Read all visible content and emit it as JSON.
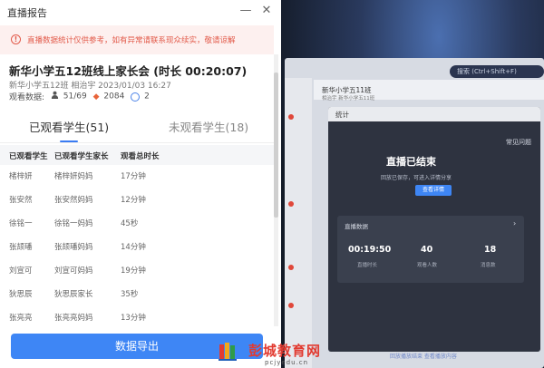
{
  "window": {
    "title": "直播报告",
    "minimize_glyph": "—",
    "close_glyph": "✕"
  },
  "notice": {
    "text": "直播数据统计仅供参考，如有异常请联系现众续实，敬请谅解"
  },
  "meeting": {
    "title": "新华小学五12班线上家长会 (时长 00:20:07)",
    "subtitle": "新华小学五12班  相治宇  2023/01/03 16:27",
    "stats_label": "观看数据:",
    "viewers": "51/69",
    "likes": "2084",
    "comments": "2"
  },
  "tabs": {
    "watched": "已观看学生(51)",
    "unwatched": "未观看学生(18)"
  },
  "table": {
    "headers": [
      "已观看学生",
      "已观看学生家长",
      "观看总时长"
    ],
    "rows": [
      [
        "楮梓妍",
        "楮梓妍妈妈",
        "17分钟"
      ],
      [
        "张安然",
        "张安然妈妈",
        "12分钟"
      ],
      [
        "徐铭一",
        "徐铭一妈妈",
        "45秒"
      ],
      [
        "张颉璠",
        "张颉璠妈妈",
        "14分钟"
      ],
      [
        "刘宣可",
        "刘宣可妈妈",
        "19分钟"
      ],
      [
        "狄思辰",
        "狄思辰家长",
        "35秒"
      ],
      [
        "张亮亮",
        "张亮亮妈妈",
        "13分钟"
      ]
    ]
  },
  "export_button": "数据导出",
  "photo": {
    "search_placeholder": "搜索 (Ctrl+Shift+F)",
    "class_title": "新华小学五11班",
    "class_sub": "相治宇 新华小学五11班",
    "stats_window_title": "统计",
    "faq": "常见问题",
    "ended": "直播已结束",
    "ended_sub": "回放已保存，可进入详情分享",
    "detail_button": "查看详情",
    "card_label": "直播数据",
    "metrics": [
      {
        "value": "00:19:50",
        "label": "直播时长"
      },
      {
        "value": "40",
        "label": "观看人数"
      },
      {
        "value": "18",
        "label": "消息数"
      }
    ],
    "bottom_links": "回放播放结束    查看播放内容"
  },
  "watermark": {
    "brand": "彭城教育网",
    "url": "pcjyedu.cn"
  },
  "colors": {
    "accent": "#3e86f5",
    "warning": "#e25a4a",
    "watermark_red": "#e23b31"
  }
}
